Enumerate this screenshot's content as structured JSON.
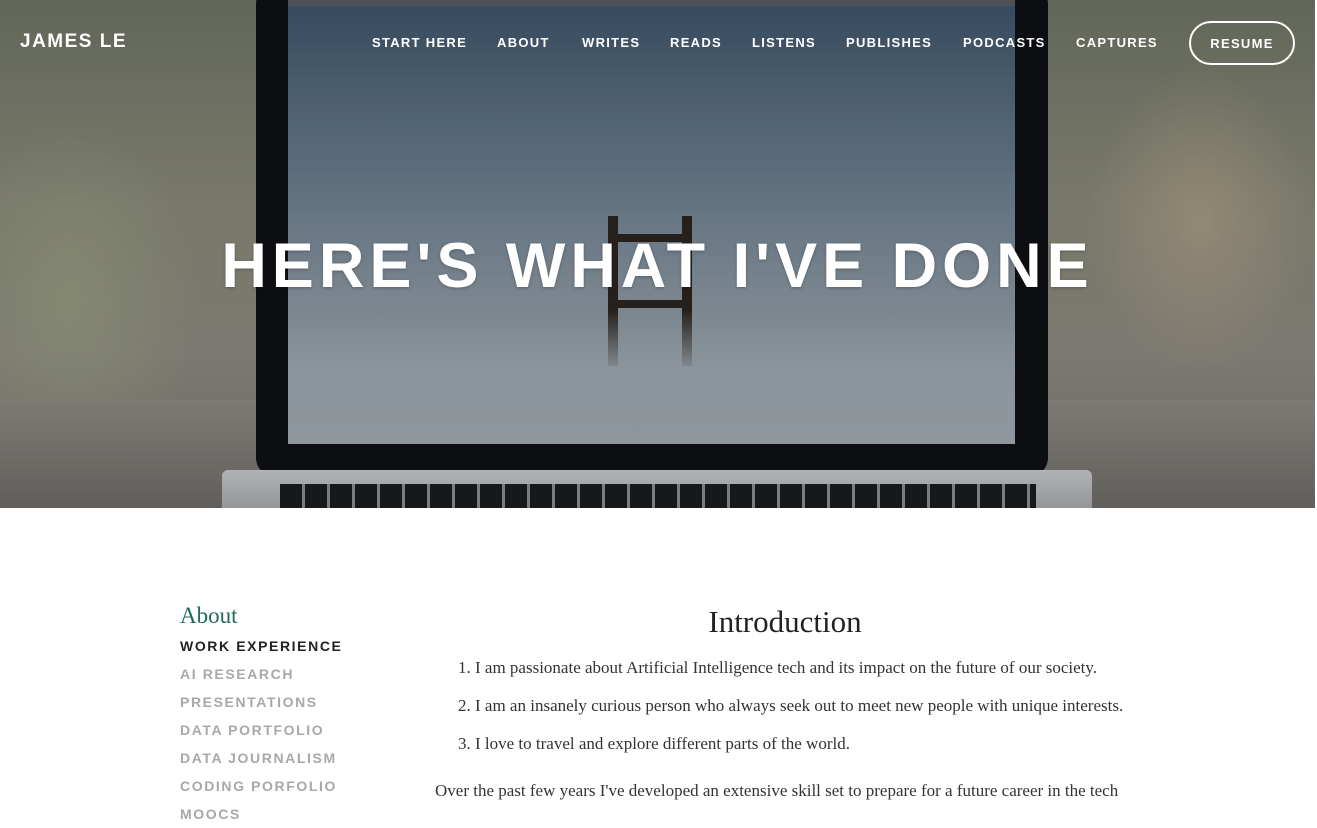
{
  "header": {
    "brand": "JAMES LE",
    "nav": [
      "START HERE",
      "ABOUT",
      "WRITES",
      "READS",
      "LISTENS",
      "PUBLISHES",
      "PODCASTS",
      "CAPTURES"
    ],
    "resume_label": "RESUME"
  },
  "hero": {
    "title": "HERE'S WHAT I'VE DONE"
  },
  "sidebar": {
    "heading": "About",
    "items": [
      {
        "label": "WORK EXPERIENCE",
        "active": true
      },
      {
        "label": "AI RESEARCH",
        "active": false
      },
      {
        "label": "PRESENTATIONS",
        "active": false
      },
      {
        "label": "DATA PORTFOLIO",
        "active": false
      },
      {
        "label": "DATA JOURNALISM",
        "active": false
      },
      {
        "label": "CODING PORFOLIO",
        "active": false
      },
      {
        "label": "MOOCS",
        "active": false
      }
    ]
  },
  "main": {
    "title": "Introduction",
    "list": [
      "I am passionate about Artificial Intelligence tech and its impact on the future of our society.",
      "I am an insanely curious person who always seek out to meet new people with unique interests.",
      "I love to travel and explore different parts of the world."
    ],
    "paragraph": "Over the past few years I've developed an extensive skill set to prepare for a future career in the tech"
  },
  "colors": {
    "accent": "#1e6b5c",
    "active_text": "#222222",
    "muted_text": "#a8a8a8"
  }
}
